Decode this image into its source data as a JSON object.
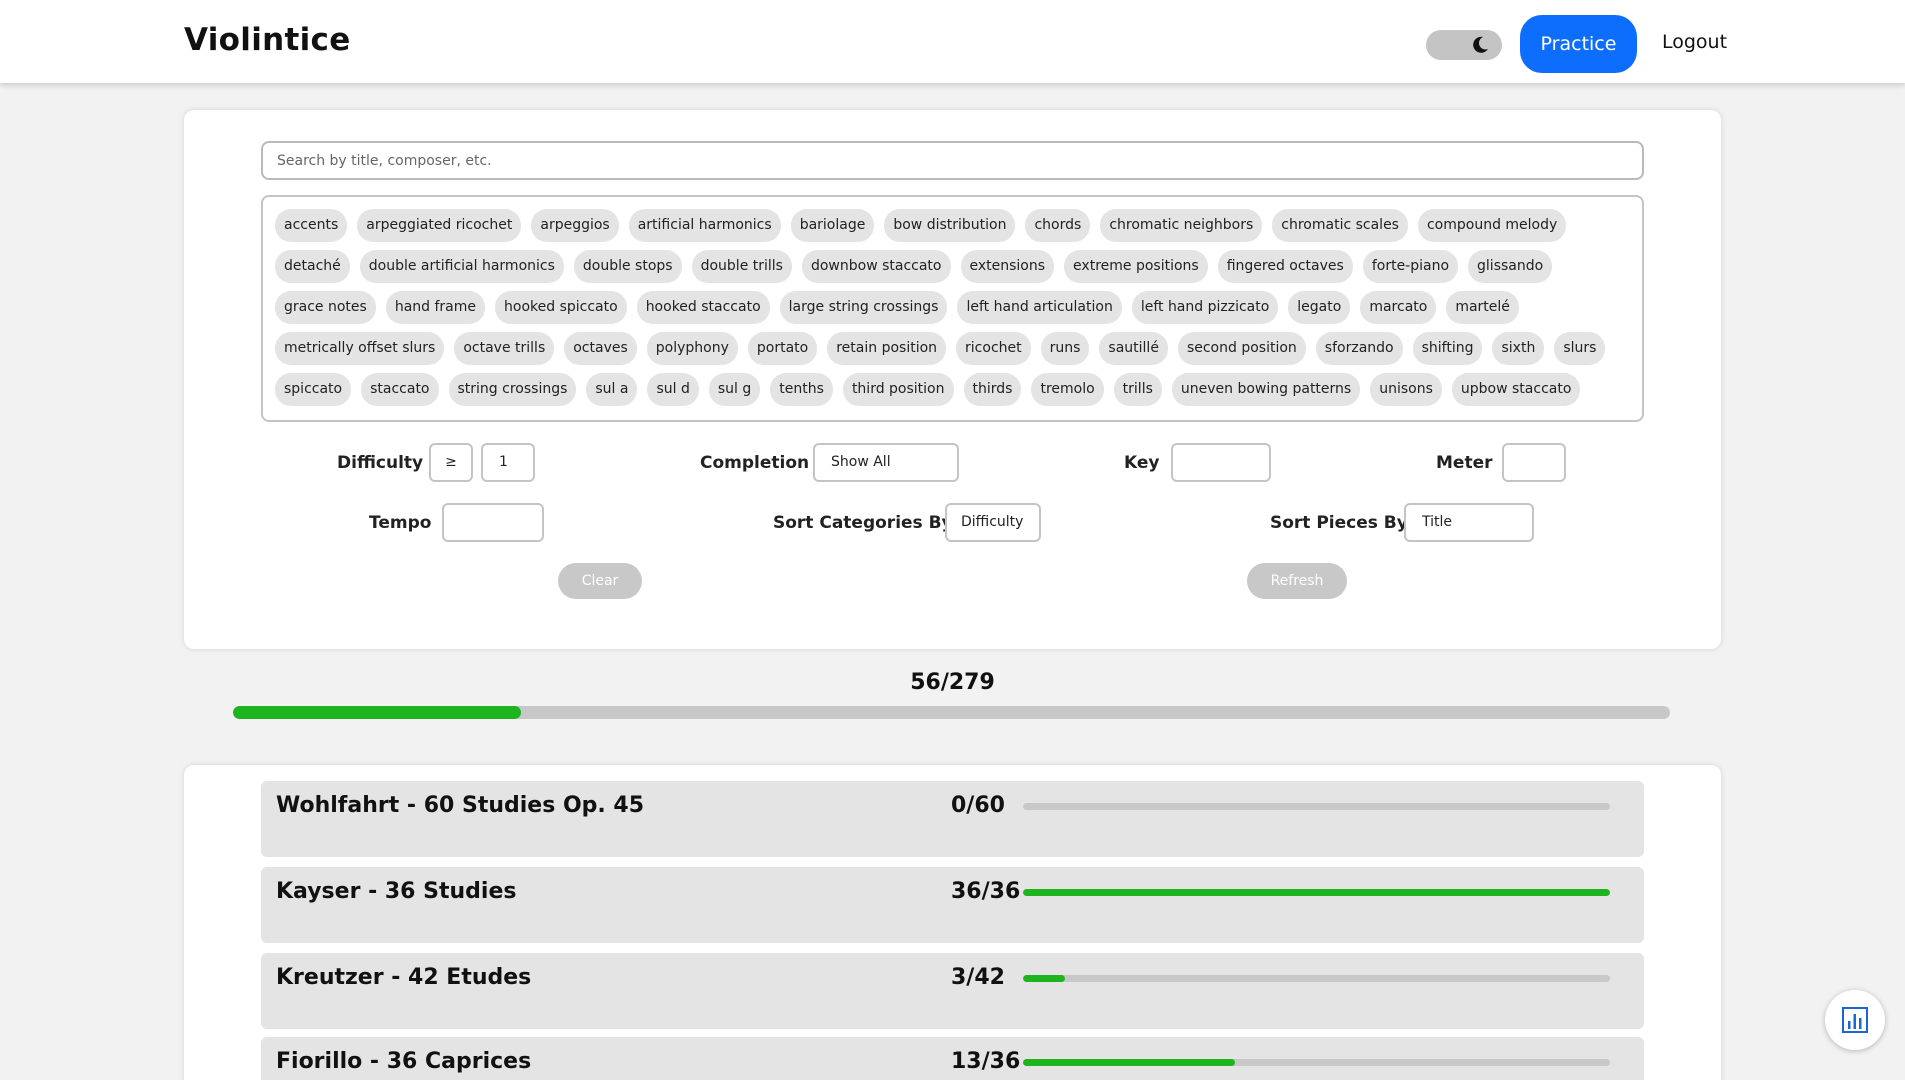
{
  "app": {
    "brand": "Violintice",
    "practice_label": "Practice",
    "logout_label": "Logout"
  },
  "search": {
    "placeholder": "Search by title, composer, etc."
  },
  "tags": [
    "accents",
    "arpeggiated ricochet",
    "arpeggios",
    "artificial harmonics",
    "bariolage",
    "bow distribution",
    "chords",
    "chromatic neighbors",
    "chromatic scales",
    "compound melody",
    "detaché",
    "double artificial harmonics",
    "double stops",
    "double trills",
    "downbow staccato",
    "extensions",
    "extreme positions",
    "fingered octaves",
    "forte-piano",
    "glissando",
    "grace notes",
    "hand frame",
    "hooked spiccato",
    "hooked staccato",
    "large string crossings",
    "left hand articulation",
    "left hand pizzicato",
    "legato",
    "marcato",
    "martelé",
    "metrically offset slurs",
    "octave trills",
    "octaves",
    "polyphony",
    "portato",
    "retain position",
    "ricochet",
    "runs",
    "sautillé",
    "second position",
    "sforzando",
    "shifting",
    "sixth",
    "slurs",
    "spiccato",
    "staccato",
    "string crossings",
    "sul a",
    "sul d",
    "sul g",
    "tenths",
    "third position",
    "thirds",
    "tremolo",
    "trills",
    "uneven bowing patterns",
    "unisons",
    "upbow staccato"
  ],
  "filters": {
    "difficulty_label": "Difficulty",
    "difficulty_op": "≥",
    "difficulty_value": "1",
    "completion_label": "Completion",
    "completion_value": "Show All",
    "key_label": "Key",
    "key_value": "",
    "meter_label": "Meter",
    "meter_value": "",
    "tempo_label": "Tempo",
    "tempo_value": "",
    "sort_categories_label": "Sort Categories By",
    "sort_categories_value": "Difficulty",
    "sort_pieces_label": "Sort Pieces By",
    "sort_pieces_value": "Title",
    "clear_label": "Clear",
    "refresh_label": "Refresh"
  },
  "overall": {
    "count": "56/279",
    "progress": 0.2007
  },
  "collections": [
    {
      "title": "Wohlfahrt - 60 Studies Op. 45",
      "count": "0/60",
      "progress": 0.0
    },
    {
      "title": "Kayser - 36 Studies",
      "count": "36/36",
      "progress": 1.0
    },
    {
      "title": "Kreutzer - 42 Etudes",
      "count": "3/42",
      "progress": 0.0714
    },
    {
      "title": "Fiorillo - 36 Caprices",
      "count": "13/36",
      "progress": 0.3611
    }
  ],
  "colors": {
    "accent": "#0d6efd",
    "progress": "#1db41d",
    "track": "#c8c8c8"
  },
  "icons": {
    "theme_toggle": "moon-icon",
    "stats": "bar-chart-icon"
  }
}
